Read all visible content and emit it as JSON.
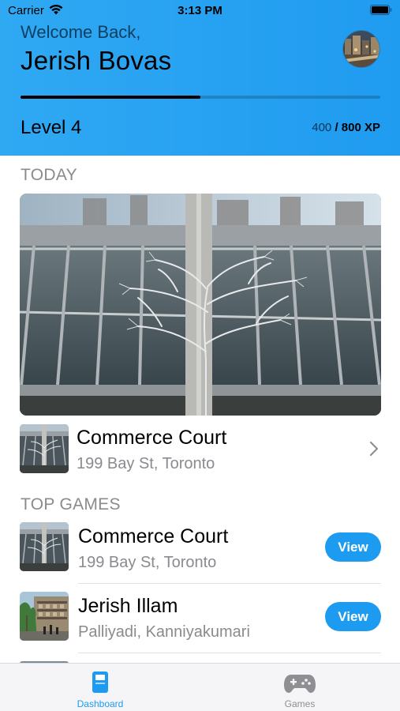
{
  "status_bar": {
    "carrier": "Carrier",
    "time": "3:13 PM"
  },
  "header": {
    "greeting": "Welcome Back,",
    "user_name": "Jerish Bovas",
    "level": "Level 4",
    "xp_current": "400",
    "xp_total": "/ 800 XP",
    "progress_fraction": 0.5
  },
  "today": {
    "section_title": "TODAY",
    "featured": {
      "title": "Commerce Court",
      "address": "199 Bay St, Toronto"
    }
  },
  "top_games": {
    "section_title": "TOP GAMES",
    "items": [
      {
        "title": "Commerce Court",
        "address": "199 Bay St, Toronto",
        "button_label": "View"
      },
      {
        "title": "Jerish Illam",
        "address": "Palliyadi, Kanniyakumari",
        "button_label": "View"
      }
    ]
  },
  "tab_bar": {
    "tabs": [
      {
        "label": "Dashboard",
        "icon": "book-icon",
        "selected": true
      },
      {
        "label": "Games",
        "icon": "gamepad-icon",
        "selected": false
      }
    ]
  },
  "colors": {
    "header_blue": "#1f9bf0",
    "accent_blue": "#1d9bf0",
    "secondary_text": "#8a8a8f",
    "tab_inactive": "#8e8e93"
  }
}
